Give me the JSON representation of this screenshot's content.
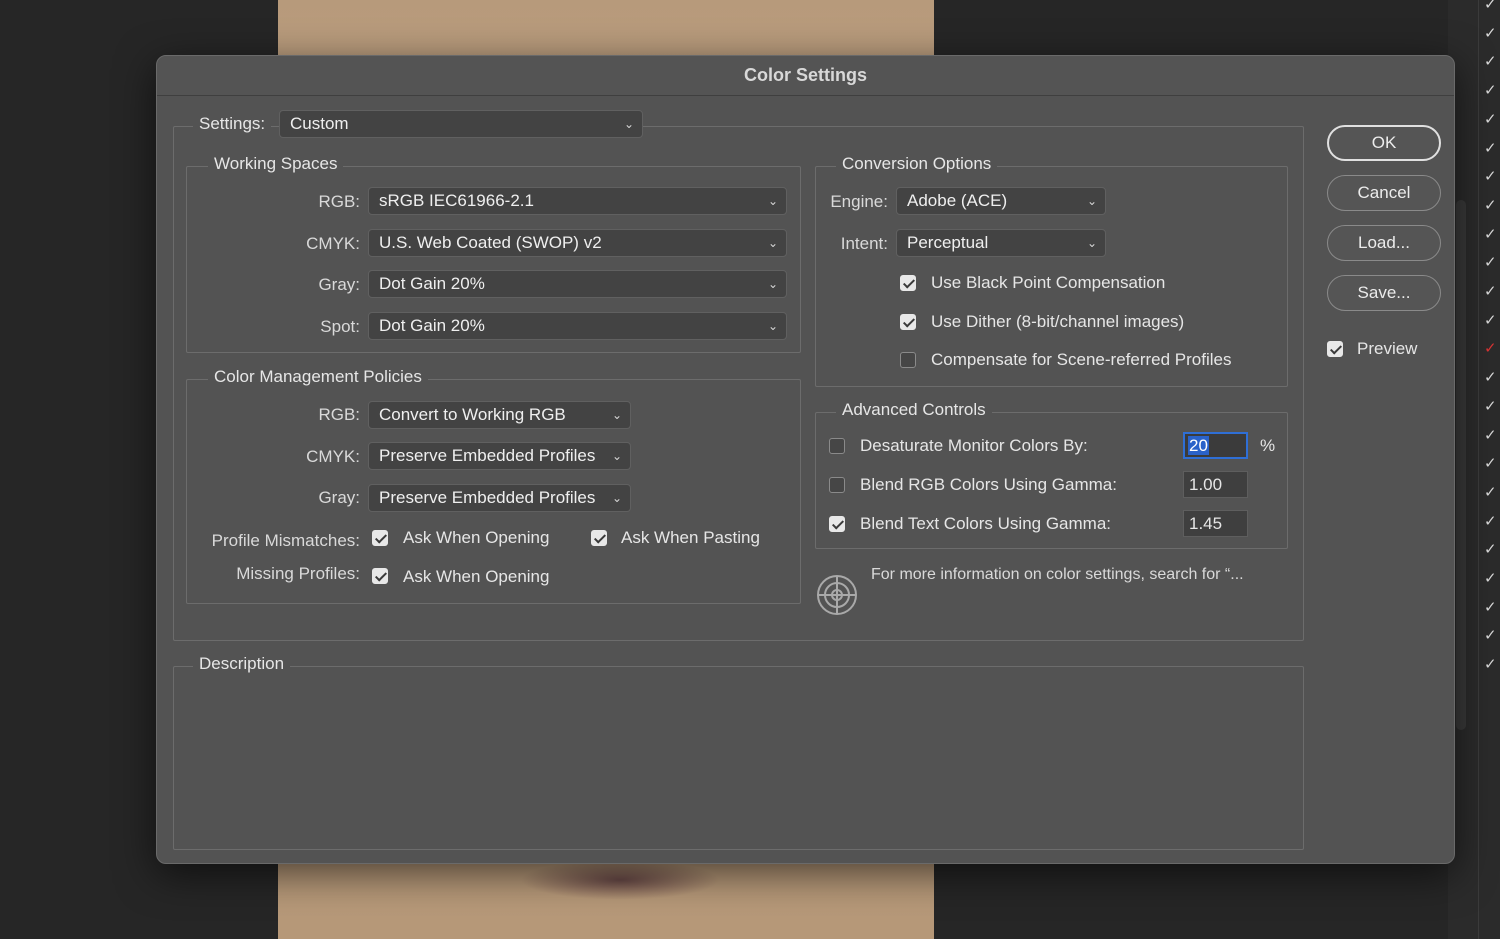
{
  "dialog": {
    "title": "Color Settings"
  },
  "settings": {
    "label": "Settings:",
    "value": "Custom"
  },
  "working_spaces": {
    "title": "Working Spaces",
    "rgb": {
      "label": "RGB:",
      "value": "sRGB IEC61966-2.1"
    },
    "cmyk": {
      "label": "CMYK:",
      "value": "U.S. Web Coated (SWOP) v2"
    },
    "gray": {
      "label": "Gray:",
      "value": "Dot Gain 20%"
    },
    "spot": {
      "label": "Spot:",
      "value": "Dot Gain 20%"
    }
  },
  "policies": {
    "title": "Color Management Policies",
    "rgb": {
      "label": "RGB:",
      "value": "Convert to Working RGB"
    },
    "cmyk": {
      "label": "CMYK:",
      "value": "Preserve Embedded Profiles"
    },
    "gray": {
      "label": "Gray:",
      "value": "Preserve Embedded Profiles"
    },
    "mismatch_label": "Profile Mismatches:",
    "mismatch_opening": {
      "label": "Ask When Opening",
      "checked": true
    },
    "mismatch_pasting": {
      "label": "Ask When Pasting",
      "checked": true
    },
    "missing_label": "Missing Profiles:",
    "missing_opening": {
      "label": "Ask When Opening",
      "checked": true
    }
  },
  "conversion": {
    "title": "Conversion Options",
    "engine": {
      "label": "Engine:",
      "value": "Adobe (ACE)"
    },
    "intent": {
      "label": "Intent:",
      "value": "Perceptual"
    },
    "black_point": {
      "label": "Use Black Point Compensation",
      "checked": true
    },
    "dither": {
      "label": "Use Dither (8-bit/channel images)",
      "checked": true
    },
    "scene_referred": {
      "label": "Compensate for Scene-referred Profiles",
      "checked": false
    }
  },
  "advanced": {
    "title": "Advanced Controls",
    "desaturate": {
      "label": "Desaturate Monitor Colors By:",
      "checked": false,
      "value": "20",
      "unit": "%"
    },
    "blend_rgb": {
      "label": "Blend RGB Colors Using Gamma:",
      "checked": false,
      "value": "1.00"
    },
    "blend_text": {
      "label": "Blend Text Colors Using Gamma:",
      "checked": true,
      "value": "1.45"
    }
  },
  "info_text": "For more information on color settings, search for “...",
  "description": {
    "title": "Description"
  },
  "buttons": {
    "ok": "OK",
    "cancel": "Cancel",
    "load": "Load...",
    "save": "Save..."
  },
  "preview": {
    "label": "Preview",
    "checked": true
  },
  "colors": {
    "focus_blue": "#2f6fd6",
    "selection_blue": "#2a62c9",
    "dialog_bg": "#535353",
    "red_check": "#d93434"
  }
}
